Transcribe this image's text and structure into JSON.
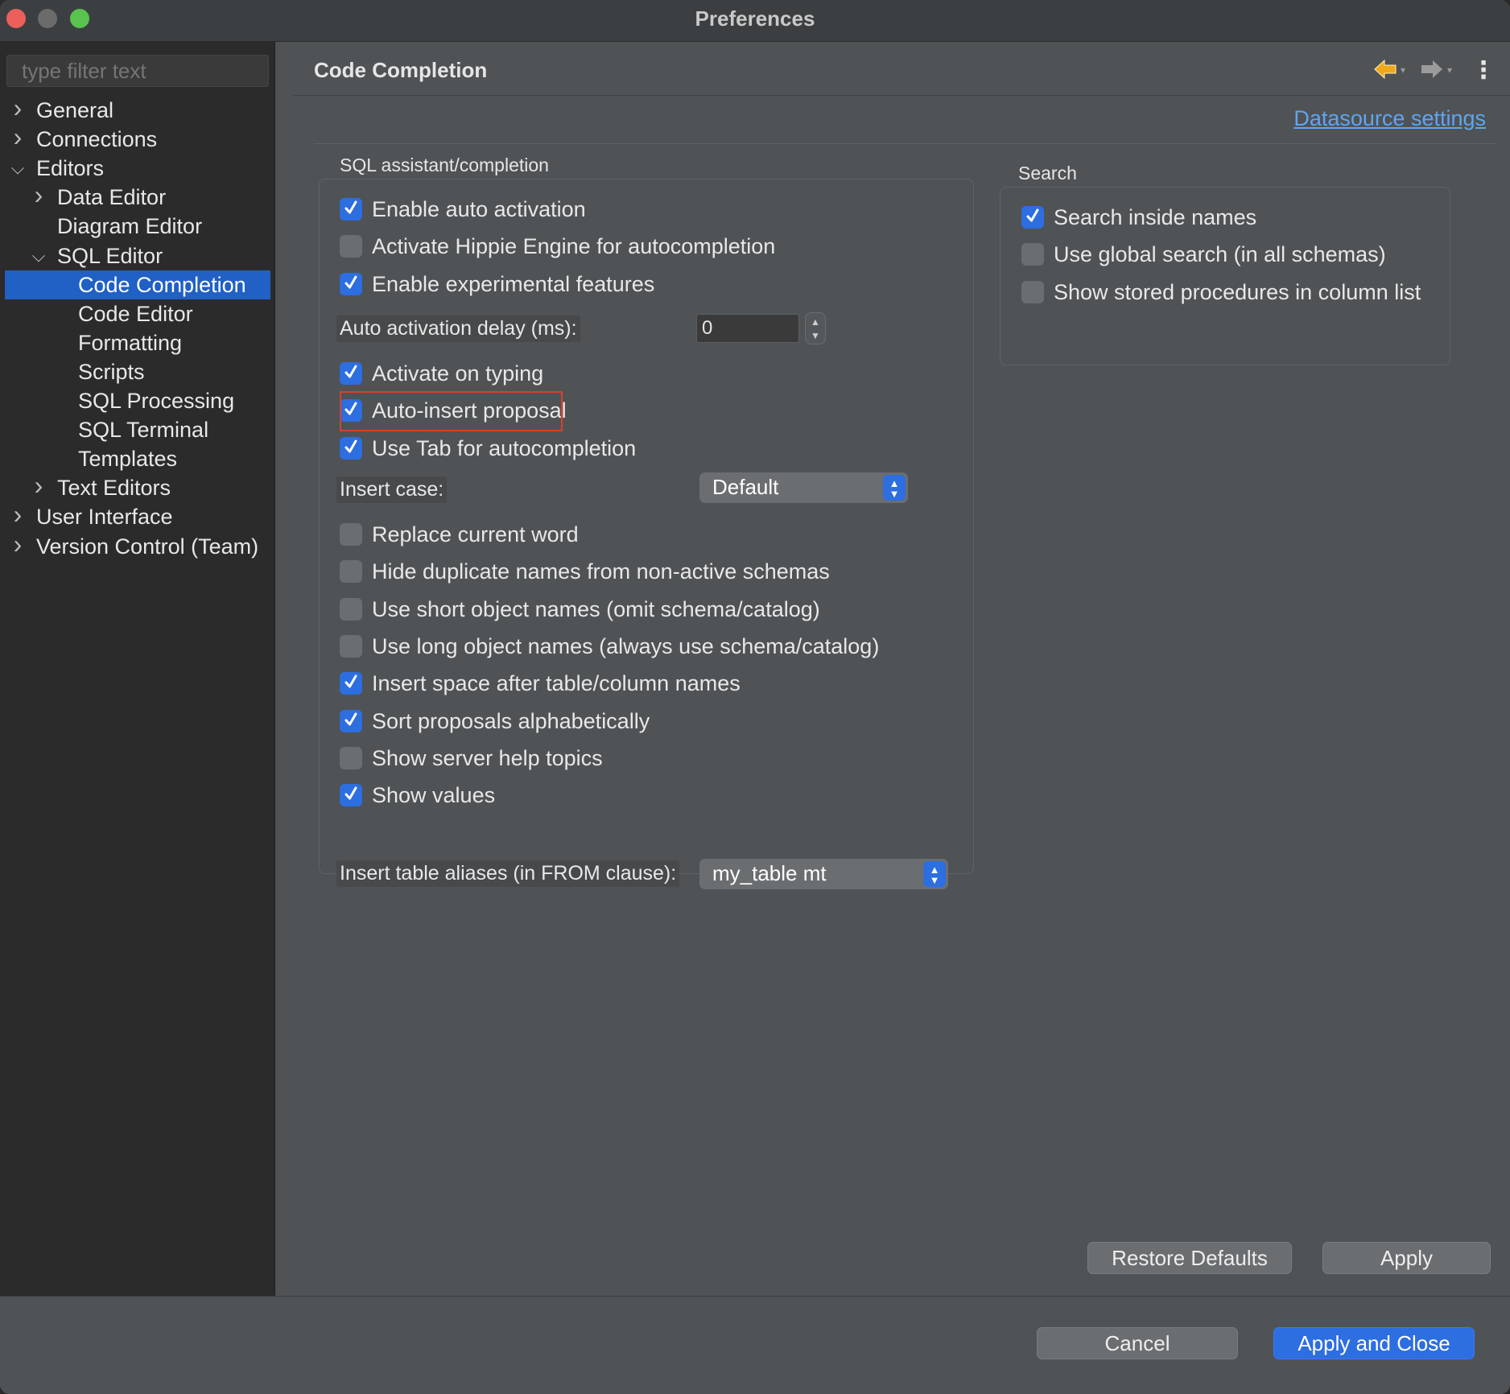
{
  "window": {
    "title": "Preferences"
  },
  "sidebar": {
    "filter_placeholder": "type filter text",
    "items": [
      {
        "label": "General",
        "indent": 0,
        "expander": "collapsed"
      },
      {
        "label": "Connections",
        "indent": 0,
        "expander": "collapsed"
      },
      {
        "label": "Editors",
        "indent": 0,
        "expander": "expanded"
      },
      {
        "label": "Data Editor",
        "indent": 1,
        "expander": "collapsed"
      },
      {
        "label": "Diagram Editor",
        "indent": 1,
        "expander": "none"
      },
      {
        "label": "SQL Editor",
        "indent": 1,
        "expander": "expanded"
      },
      {
        "label": "Code Completion",
        "indent": 2,
        "expander": "none",
        "selected": true
      },
      {
        "label": "Code Editor",
        "indent": 2,
        "expander": "none"
      },
      {
        "label": "Formatting",
        "indent": 2,
        "expander": "none"
      },
      {
        "label": "Scripts",
        "indent": 2,
        "expander": "none"
      },
      {
        "label": "SQL Processing",
        "indent": 2,
        "expander": "none"
      },
      {
        "label": "SQL Terminal",
        "indent": 2,
        "expander": "none"
      },
      {
        "label": "Templates",
        "indent": 2,
        "expander": "none"
      },
      {
        "label": "Text Editors",
        "indent": 1,
        "expander": "collapsed"
      },
      {
        "label": "User Interface",
        "indent": 0,
        "expander": "collapsed"
      },
      {
        "label": "Version Control (Team)",
        "indent": 0,
        "expander": "collapsed"
      }
    ]
  },
  "header": {
    "title": "Code Completion",
    "back_icon": "back-arrow-icon",
    "forward_icon": "forward-arrow-icon",
    "menu_icon": "vertical-dots-icon"
  },
  "datasource_link": "Datasource settings",
  "sql_group": {
    "label": "SQL assistant/completion",
    "checks_top": [
      {
        "label": "Enable auto activation",
        "checked": true
      },
      {
        "label": "Activate Hippie Engine for autocompletion",
        "checked": false
      },
      {
        "label": "Enable experimental features",
        "checked": true
      }
    ],
    "delay_label": "Auto activation delay (ms):",
    "delay_value": "0",
    "checks_mid": [
      {
        "label": "Activate on typing",
        "checked": true
      },
      {
        "label": "Auto-insert proposal",
        "checked": true
      },
      {
        "label": "Use Tab for autocompletion",
        "checked": true
      }
    ],
    "insert_case_label": "Insert case:",
    "insert_case_value": "Default",
    "checks_bottom": [
      {
        "label": "Replace current word",
        "checked": false
      },
      {
        "label": "Hide duplicate names from non-active schemas",
        "checked": false
      },
      {
        "label": "Use short object names (omit schema/catalog)",
        "checked": false
      },
      {
        "label": "Use long object names (always use schema/catalog)",
        "checked": false
      },
      {
        "label": "Insert space after table/column names",
        "checked": true
      },
      {
        "label": "Sort proposals alphabetically",
        "checked": true
      },
      {
        "label": "Show server help topics",
        "checked": false
      },
      {
        "label": "Show values",
        "checked": true
      }
    ],
    "aliases_label": "Insert table aliases (in FROM clause):",
    "aliases_value": "my_table mt"
  },
  "search_group": {
    "label": "Search",
    "checks": [
      {
        "label": "Search inside names",
        "checked": true
      },
      {
        "label": "Use global search (in all schemas)",
        "checked": false
      },
      {
        "label": "Show stored procedures in column list",
        "checked": false
      }
    ]
  },
  "buttons": {
    "restore_defaults": "Restore Defaults",
    "apply": "Apply",
    "cancel": "Cancel",
    "apply_and_close": "Apply and Close"
  },
  "colors": {
    "accent": "#2d6ee0",
    "selection": "#2160c4",
    "highlight_border": "#d8402c",
    "link": "#5fa5f0"
  }
}
